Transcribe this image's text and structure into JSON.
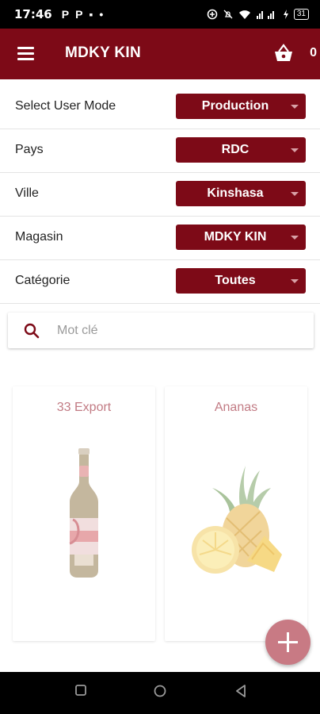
{
  "status_bar": {
    "time": "17:46",
    "notifications": [
      "P",
      "P",
      "▪",
      "•"
    ],
    "battery": "31"
  },
  "app_bar": {
    "title": "MDKY KIN",
    "cart_count": "0"
  },
  "filters": [
    {
      "label": "Select User Mode",
      "value": "Production"
    },
    {
      "label": "Pays",
      "value": "RDC"
    },
    {
      "label": "Ville",
      "value": "Kinshasa"
    },
    {
      "label": "Magasin",
      "value": "MDKY KIN"
    },
    {
      "label": "Catégorie",
      "value": "Toutes"
    }
  ],
  "search": {
    "placeholder": "Mot clé"
  },
  "products": [
    {
      "name": "33 Export",
      "image_icon": "beer-bottle-image"
    },
    {
      "name": "Ananas",
      "image_icon": "pineapple-image"
    }
  ],
  "colors": {
    "primary": "#7d0a17",
    "product_name": "#c27b84",
    "fab": "#c87a84"
  }
}
